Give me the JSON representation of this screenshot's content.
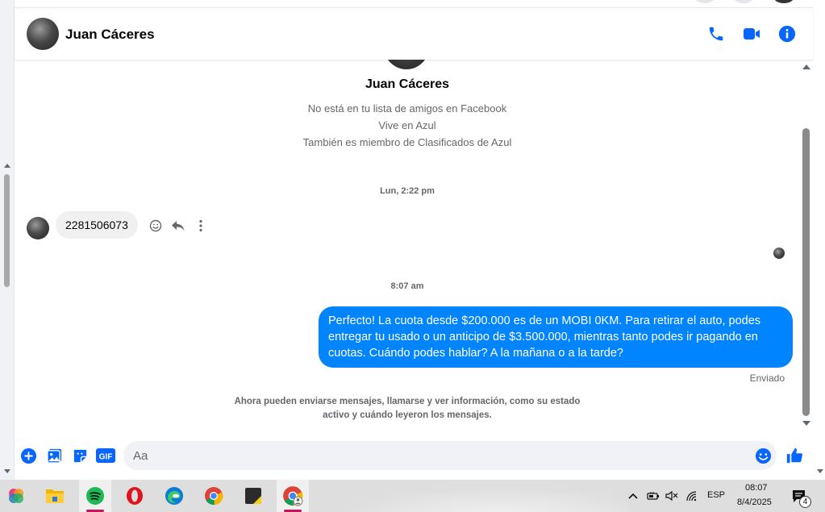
{
  "header": {
    "contact_name": "Juan Cáceres"
  },
  "profile": {
    "name": "Juan Cáceres",
    "lines": [
      "No está en tu lista de amigos en Facebook",
      "Vive en Azul",
      "También es miembro de Clasificados de Azul"
    ]
  },
  "messages": {
    "timestamp_1": "Lun, 2:22 pm",
    "incoming_1": "2281506073",
    "timestamp_2": "8:07 am",
    "outgoing_1": "Perfecto! La cuota desde $200.000 es de un MOBI 0KM. Para retirar el auto, podes entregar tu usado o un anticipo de $3.500.000, mientras tanto podes ir pagando en cuotas. Cuándo podes hablar? A la mañana o a la tarde?",
    "outgoing_status": "Enviado",
    "notice": "Ahora pueden enviarse mensajes, llamarse y ver información, como su estado activo y cuándo leyeron los mensajes."
  },
  "composer": {
    "placeholder": "Aa",
    "gif_label": "GIF"
  },
  "taskbar": {
    "language": "ESP",
    "time": "08:07",
    "date": "8/4/2025",
    "notification_count": "4"
  },
  "colors": {
    "accent": "#0084ff",
    "icon_blue": "#0866ff",
    "incoming_bubble": "#f0f0f0"
  }
}
